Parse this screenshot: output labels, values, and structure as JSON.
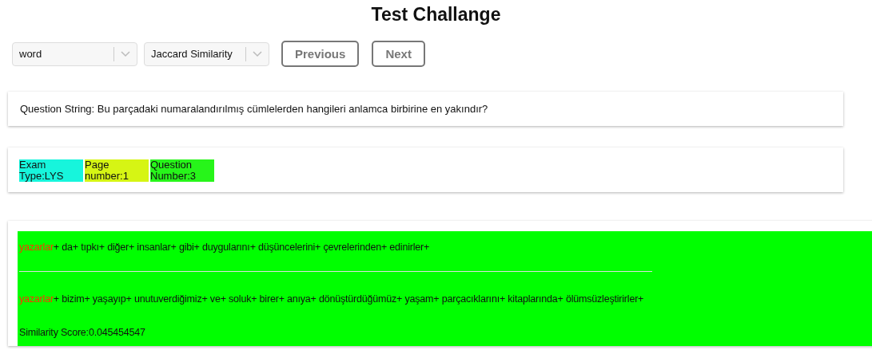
{
  "title": "Test Challange",
  "selects": [
    {
      "value": "word"
    },
    {
      "value": "Jaccard Similarity"
    }
  ],
  "buttons": [
    "Previous",
    "Next"
  ],
  "question": "Question String: Bu parçadaki numaralandırılmış cümlelerden hangileri anlamca birbirine en yakındır?",
  "tags": [
    {
      "text": "Exam Type:LYS",
      "color": "#17f5dc"
    },
    {
      "text": "Page number:1",
      "color": "#d6f514"
    },
    {
      "text": "Question Number:3",
      "color": "#27f51a"
    }
  ],
  "result": {
    "color": "#00ff00",
    "separator": "+",
    "sentences": [
      [
        {
          "text": "yazarlar",
          "matched": true
        },
        {
          "text": "da",
          "matched": false
        },
        {
          "text": "tıpkı",
          "matched": false
        },
        {
          "text": "diğer",
          "matched": false
        },
        {
          "text": "insanlar",
          "matched": false
        },
        {
          "text": "gibi",
          "matched": false
        },
        {
          "text": "duygularını",
          "matched": false
        },
        {
          "text": "düşüncelerini",
          "matched": false
        },
        {
          "text": "çevrelerinden",
          "matched": false
        },
        {
          "text": "edinirler",
          "matched": false
        }
      ],
      [
        {
          "text": "yazarlar",
          "matched": true
        },
        {
          "text": "bizim",
          "matched": false
        },
        {
          "text": "yaşayıp",
          "matched": false
        },
        {
          "text": "unutuverdiğimiz",
          "matched": false
        },
        {
          "text": "ve",
          "matched": false
        },
        {
          "text": "soluk",
          "matched": false
        },
        {
          "text": "birer",
          "matched": false
        },
        {
          "text": "anıya",
          "matched": false
        },
        {
          "text": "dönüştürdüğümüz",
          "matched": false
        },
        {
          "text": "yaşam",
          "matched": false
        },
        {
          "text": "parçacıklarını",
          "matched": false
        },
        {
          "text": "kitaplarında",
          "matched": false
        },
        {
          "text": "ölümsüzleştirirler",
          "matched": false
        }
      ]
    ],
    "score": "Similarity Score:0.045454547"
  }
}
